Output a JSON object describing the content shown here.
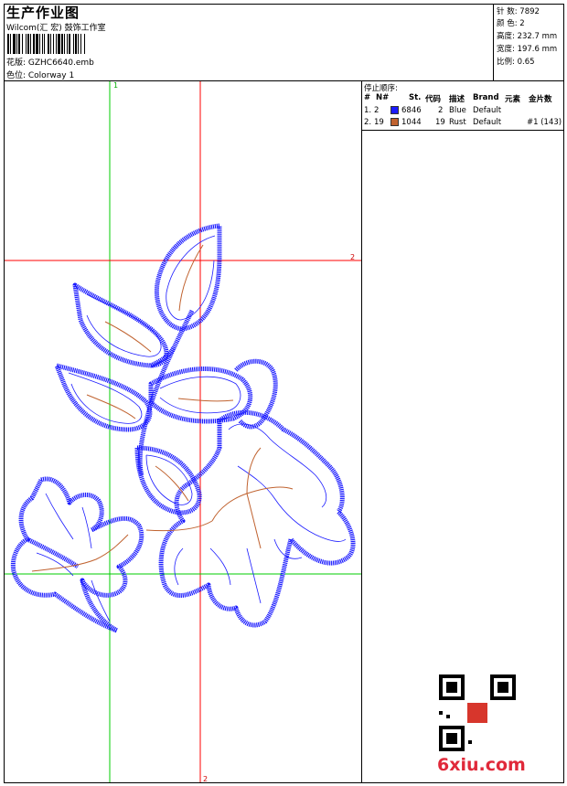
{
  "header": {
    "title": "生产作业图",
    "company": "Wilcom(汇 宏) 鼓饰工作室",
    "design_file": "花版:  GZHC6640.emb",
    "colorway": "色位:  Colorway 1"
  },
  "stats": [
    {
      "label": "针 数:",
      "value": "7892"
    },
    {
      "label": "颜 色:",
      "value": "2"
    },
    {
      "label": "高度:",
      "value": "232.7 mm"
    },
    {
      "label": "宽度:",
      "value": "197.6 mm"
    },
    {
      "label": "比例:",
      "value": "0.65"
    }
  ],
  "sequence": {
    "title": "停止顺序:",
    "columns": [
      "#",
      "N#",
      "St.",
      "代码",
      "描述",
      "Brand",
      "元素",
      "金片数"
    ],
    "rows": [
      {
        "n": "1.",
        "nn": "2",
        "color": "#1b1bff",
        "st": "6846",
        "code": "2",
        "desc": "Blue",
        "brand": "Default",
        "elem": "",
        "seq": ""
      },
      {
        "n": "2.",
        "nn": "19",
        "color": "#c0622f",
        "st": "1044",
        "code": "19",
        "desc": "Rust",
        "brand": "Default",
        "elem": "",
        "seq": "#1 (143)"
      }
    ]
  },
  "guides": {
    "v_green": "1",
    "h_red": "2",
    "v_red": "2"
  },
  "watermark": "6xiu.com",
  "thread_colors": {
    "blue": "#1b1bff",
    "rust": "#c0622f",
    "guide_red": "#ff0000",
    "guide_green": "#00cc00"
  }
}
